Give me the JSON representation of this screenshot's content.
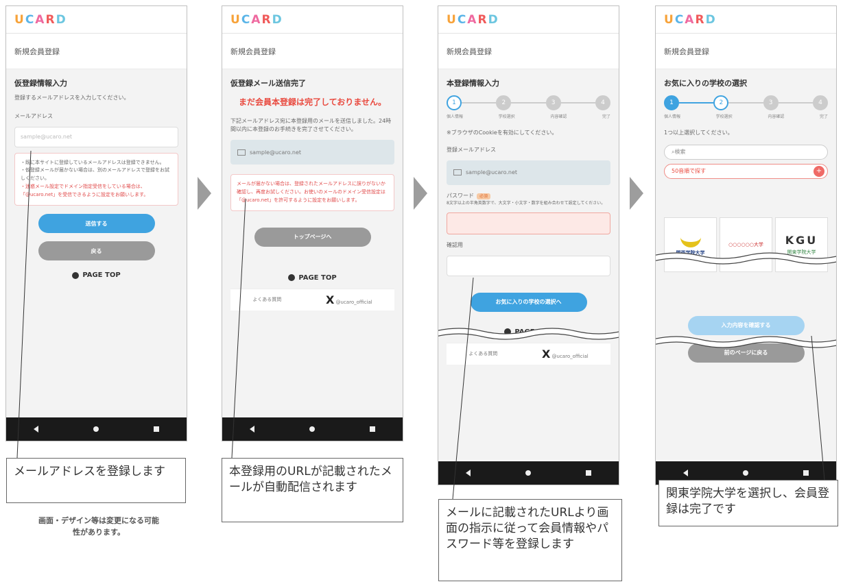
{
  "logo_letters": [
    "U",
    "C",
    "A",
    "R",
    "D"
  ],
  "page_heading": "新規会員登録",
  "page_top": "PAGE TOP",
  "screen1": {
    "section_title": "仮登録情報入力",
    "instruction": "登録するメールアドレスを入力してください。",
    "field_label": "メールアドレス",
    "email_placeholder": "sample@ucaro.net",
    "notice_lines": [
      "・既に本サイトに登録しているメールアドレスは登録できません。",
      "・仮登録メールが届かない場合は、別のメールアドレスで登録をお試しください。",
      "・迷惑メール設定でドメイン指定受信をしている場合は、「@ucaro.net」を受信できるように設定をお願いします。"
    ],
    "submit_button": "送信する",
    "back_button": "戻る"
  },
  "screen2": {
    "section_title": "仮登録メール送信完了",
    "warning": "まだ会員本登録は完了しておりません。",
    "body": "下記メールアドレス宛に本登録用のメールを送信しました。24時間以内に本登録のお手続きを完了させてください。",
    "email": "sample@ucaro.net",
    "notice": "メールが届かない場合は、登録されたメールアドレスに誤りがないか確認し、再度お試しください。お使いのメールのドメイン受信設定は「@ucaro.net」を許可するように設定をお願いします。",
    "top_button": "トップページへ",
    "faq_link": "よくある質問",
    "x_account": "@ucaro_official"
  },
  "screen3": {
    "section_title": "本登録情報入力",
    "steps": [
      "個人情報",
      "学校選択",
      "内容確認",
      "完了"
    ],
    "cookie_note": "※ブラウザのCookieを有効にしてください。",
    "email_label": "登録メールアドレス",
    "email": "sample@ucaro.net",
    "password_label": "パスワード",
    "required_tag": "必須",
    "password_hint": "8文字以上の半角英数字で、大文字・小文字・数字を組み合わせて設定してください。",
    "confirm_label": "確認用",
    "next_button": "お気に入りの学校の選択へ",
    "faq_link": "よくある質問",
    "x_account": "@ucaro_official"
  },
  "screen4": {
    "section_title": "お気に入りの学校の選択",
    "steps": [
      "個人情報",
      "学校選択",
      "内容確認",
      "完了"
    ],
    "select_prompt": "1つ以上選択してください。",
    "search_placeholder": "検索",
    "school_select": "50音順で探す",
    "card_1": "関西学院大学",
    "card_2": "○○○○○○大学",
    "card_3_logo": "KGU",
    "card_3_name": "関東学院大学",
    "confirm_button": "入力内容を確認する",
    "back_button": "前のページに戻る"
  },
  "callouts": {
    "c1": "メールアドレスを登録します",
    "c2": "本登録用のURLが記載されたメールが自動配信されます",
    "c3": "メールに記載されたURLより画面の指示に従って会員情報やパスワード等を登録します",
    "c4": "関東学院大学を選択し、会員登録は完了です"
  },
  "disclaimer": "画面・デザイン等は変更になる可能性があります。",
  "colors": {
    "accent": "#3fa3e0",
    "warning": "#e94a3f",
    "arrow": "#9d9d9d"
  }
}
